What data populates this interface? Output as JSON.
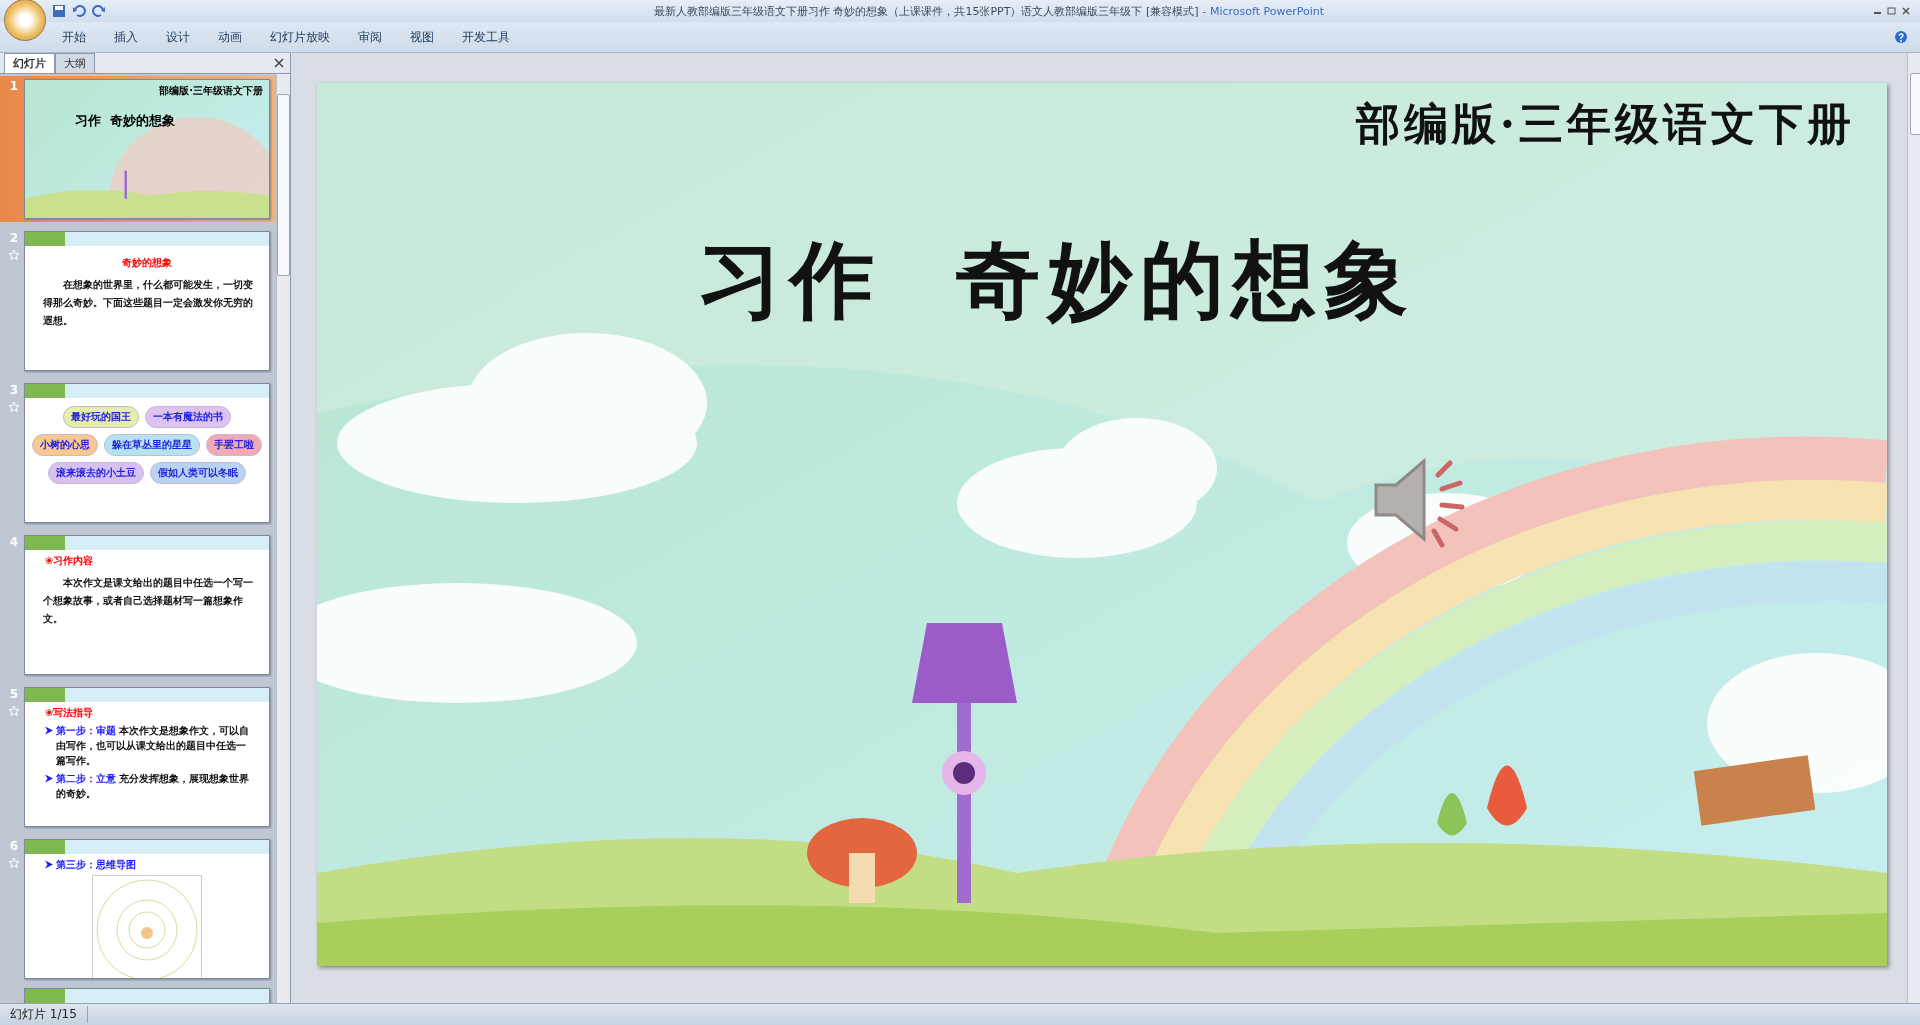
{
  "window": {
    "title": "最新人教部编版三年级语文下册习作 奇妙的想象（上课课件，共15张PPT）语文人教部编版三年级下 [兼容模式]",
    "app": "- Microsoft PowerPoint"
  },
  "ribbon_tabs": [
    "开始",
    "插入",
    "设计",
    "动画",
    "幻灯片放映",
    "审阅",
    "视图",
    "开发工具"
  ],
  "panel_tabs": [
    {
      "label": "幻灯片",
      "selected": true
    },
    {
      "label": "大纲",
      "selected": false
    }
  ],
  "thumbnails": [
    {
      "number": "1",
      "kind": "title",
      "selected": true,
      "animated": false,
      "header": "部编版·三年级语文下册",
      "title": "习作  奇妙的想象"
    },
    {
      "number": "2",
      "kind": "text",
      "selected": false,
      "animated": true,
      "heading": "奇妙的想象",
      "body": "在想象的世界里，什么都可能发生，一切变得那么奇妙。下面这些题目一定会激发你无穷的遐想。"
    },
    {
      "number": "3",
      "kind": "clouds",
      "selected": false,
      "animated": true,
      "clouds": [
        {
          "text": "最好玩的国王",
          "color": "#e6eeaa"
        },
        {
          "text": "一本有魔法的书",
          "color": "#dcc4ee"
        },
        {
          "text": "小树的心思",
          "color": "#f7c98e"
        },
        {
          "text": "躲在草丛里的星星",
          "color": "#b5e3ee"
        },
        {
          "text": "手罢工啦",
          "color": "#f1a9b4"
        },
        {
          "text": "滚来滚去的小土豆",
          "color": "#d6c1f0"
        },
        {
          "text": "假如人类可以冬眠",
          "color": "#b8d3f2"
        }
      ]
    },
    {
      "number": "4",
      "kind": "text",
      "selected": false,
      "animated": false,
      "heading": "❀习作内容",
      "body": "本次作文是课文给出的题目中任选一个写一个想象故事，或者自己选择题材写一篇想象作文。"
    },
    {
      "number": "5",
      "kind": "steps",
      "selected": false,
      "animated": true,
      "heading": "❀写法指导",
      "steps": [
        {
          "label": "第一步：审题",
          "text": "本次作文是想象作文，可以自由写作，也可以从课文给出的题目中任选一篇写作。"
        },
        {
          "label": "第二步：立意",
          "text": "充分发挥想象，展现想象世界的奇妙。"
        }
      ]
    },
    {
      "number": "6",
      "kind": "mindmap",
      "selected": false,
      "animated": true,
      "heading": "第三步：思维导图"
    }
  ],
  "slide": {
    "header": "部编版·三年级语文下册",
    "title": "习作  奇妙的想象"
  },
  "status_bar": {
    "slide_counter": "幻灯片 1/15"
  }
}
